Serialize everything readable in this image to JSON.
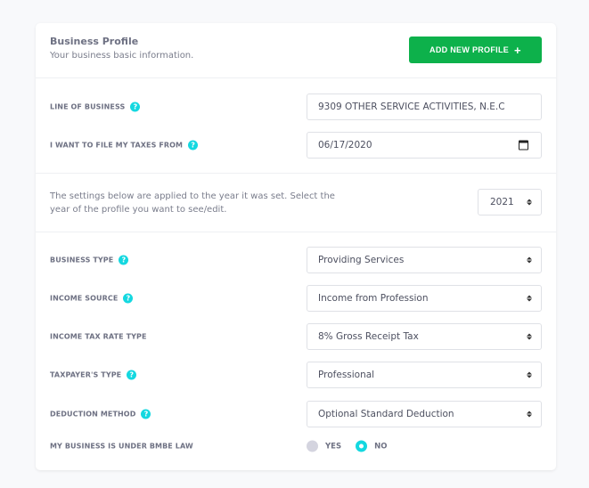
{
  "header": {
    "title": "Business Profile",
    "subtitle": "Your business basic information.",
    "add_button_label": "ADD NEW PROFILE",
    "add_button_icon": "plus-icon",
    "accent_color": "#0db14b"
  },
  "general": {
    "line_of_business": {
      "label": "LINE OF BUSINESS",
      "value": "9309 OTHER SERVICE ACTIVITIES, N.E.C",
      "help": "?"
    },
    "file_taxes_from": {
      "label": "I WANT TO FILE MY TAXES FROM",
      "value": "06/17/2020",
      "help": "?"
    }
  },
  "year_info": {
    "text": "The settings below are applied to the year it was set. Select the year of the profile you want to see/edit.",
    "selected_year": "2021"
  },
  "settings": {
    "business_type": {
      "label": "BUSINESS TYPE",
      "value": "Providing Services",
      "help": "?"
    },
    "income_source": {
      "label": "INCOME SOURCE",
      "value": "Income from Profession",
      "help": "?"
    },
    "income_tax_rate_type": {
      "label": "INCOME TAX RATE TYPE",
      "value": "8% Gross Receipt Tax"
    },
    "taxpayer_type": {
      "label": "TAXPAYER'S TYPE",
      "value": "Professional",
      "help": "?"
    },
    "deduction_method": {
      "label": "DEDUCTION METHOD",
      "value": "Optional Standard Deduction",
      "help": "?"
    },
    "bmbe": {
      "label": "MY BUSINESS IS UNDER BMBE LAW",
      "options": [
        "YES",
        "NO"
      ],
      "selected": "NO"
    }
  },
  "colors": {
    "help_icon": "#14d8e0",
    "radio_checked": "#14d8e0"
  }
}
